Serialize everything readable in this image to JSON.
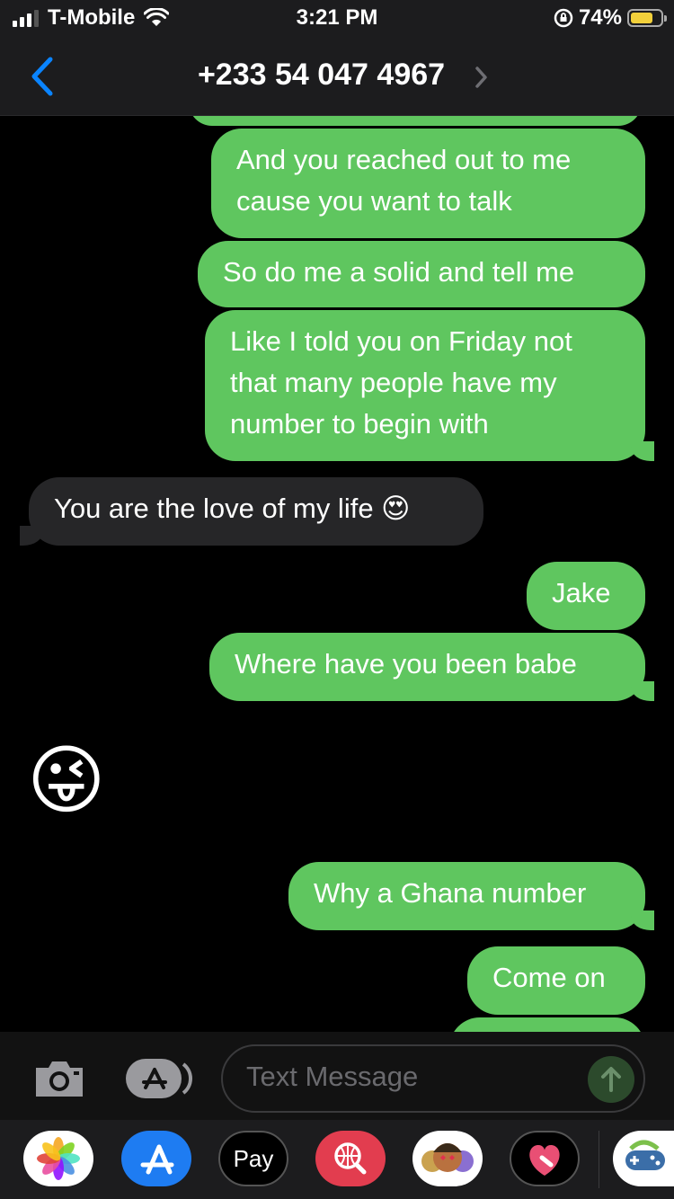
{
  "status_bar": {
    "carrier": "T-Mobile",
    "time": "3:21 PM",
    "battery_percent": "74%",
    "battery_level": 0.74,
    "battery_color": "#f2d03b"
  },
  "nav": {
    "title": "+233 54 047 4967",
    "back_icon": "chevron-left-icon",
    "details_icon": "chevron-right-icon"
  },
  "messages": [
    {
      "direction": "outgoing",
      "text": ""
    },
    {
      "direction": "outgoing",
      "text": "And you reached out to me cause you want to talk"
    },
    {
      "direction": "outgoing",
      "text": "So do me a solid and tell me"
    },
    {
      "direction": "outgoing",
      "text": "Like I told you on Friday not that many people have my number to begin with"
    },
    {
      "direction": "incoming",
      "text": "You are the love of my life 😍"
    },
    {
      "direction": "outgoing",
      "text": "Jake"
    },
    {
      "direction": "outgoing",
      "text": "Where have you been babe"
    },
    {
      "direction": "incoming",
      "text": "😜"
    },
    {
      "direction": "outgoing",
      "text": "Why a Ghana number"
    },
    {
      "direction": "outgoing",
      "text": "Come on"
    },
    {
      "direction": "outgoing",
      "text": ""
    }
  ],
  "composer": {
    "placeholder": "Text Message",
    "camera_icon": "camera-icon",
    "apps_icon": "app-store-icon",
    "send_icon": "send-arrow-icon"
  },
  "app_drawer": [
    {
      "name": "photos",
      "icon": "photos-icon"
    },
    {
      "name": "app-store",
      "icon": "app-store-icon"
    },
    {
      "name": "apple-pay",
      "label": "Pay",
      "icon": "apple-pay-icon"
    },
    {
      "name": "images-search",
      "icon": "globe-search-icon"
    },
    {
      "name": "memoji",
      "icon": "memoji-icon"
    },
    {
      "name": "digital-touch",
      "icon": "heart-touch-icon"
    },
    {
      "name": "game",
      "icon": "game-controller-icon"
    }
  ],
  "colors": {
    "outgoing_bubble": "#5fc65f",
    "incoming_bubble": "#262628",
    "accent": "#0a84ff"
  }
}
